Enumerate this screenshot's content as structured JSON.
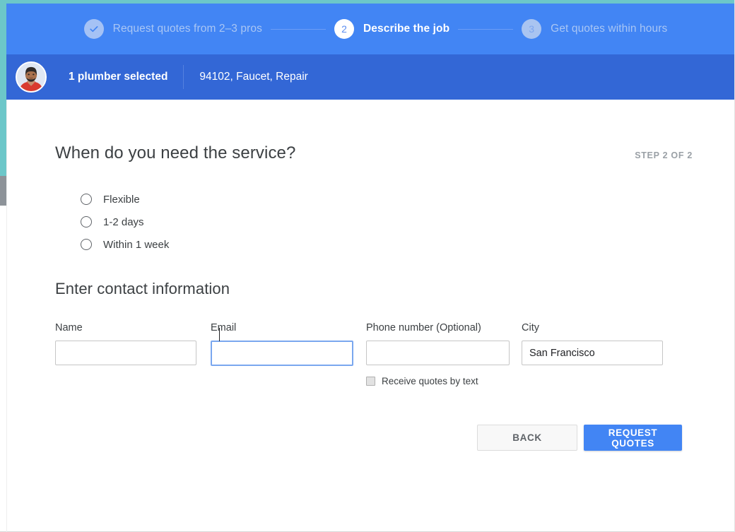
{
  "theme": {
    "header_blue": "#4285f4",
    "subheader_blue": "#3367d6",
    "accent_teal": "#6cc7c9",
    "muted_blue": "#a9c6f4",
    "text_dark": "#3c4043",
    "text_muted": "#9aa0a6",
    "focus_blue": "#7aa7ef"
  },
  "stepper": {
    "steps": [
      {
        "badge": "check-icon",
        "number": "",
        "label": "Request quotes from 2–3 pros",
        "state": "done"
      },
      {
        "badge": "number",
        "number": "2",
        "label": "Describe the job",
        "state": "active"
      },
      {
        "badge": "number",
        "number": "3",
        "label": "Get quotes within hours",
        "state": "upcoming"
      }
    ]
  },
  "subheader": {
    "avatar_alt": "pro-avatar",
    "selection_text": "1 plumber selected",
    "job_summary": "94102, Faucet, Repair"
  },
  "main": {
    "service_heading": "When do you need the service?",
    "step_counter": "STEP 2 OF 2",
    "timing_options": [
      {
        "label": "Flexible",
        "selected": false
      },
      {
        "label": "1-2 days",
        "selected": false
      },
      {
        "label": "Within 1 week",
        "selected": false
      }
    ],
    "contact_heading": "Enter contact information",
    "fields": {
      "name": {
        "label": "Name",
        "value": "",
        "placeholder": "",
        "focused": false
      },
      "email": {
        "label": "Email",
        "value": "",
        "placeholder": "",
        "focused": true
      },
      "phone": {
        "label": "Phone number (Optional)",
        "value": "",
        "placeholder": "",
        "focused": false
      },
      "city": {
        "label": "City",
        "value": "San Francisco",
        "placeholder": "",
        "focused": false
      }
    },
    "sms_optin": {
      "label": "Receive quotes by text",
      "checked": false,
      "disabled": true
    },
    "buttons": {
      "back": "BACK",
      "submit": "REQUEST QUOTES"
    }
  }
}
